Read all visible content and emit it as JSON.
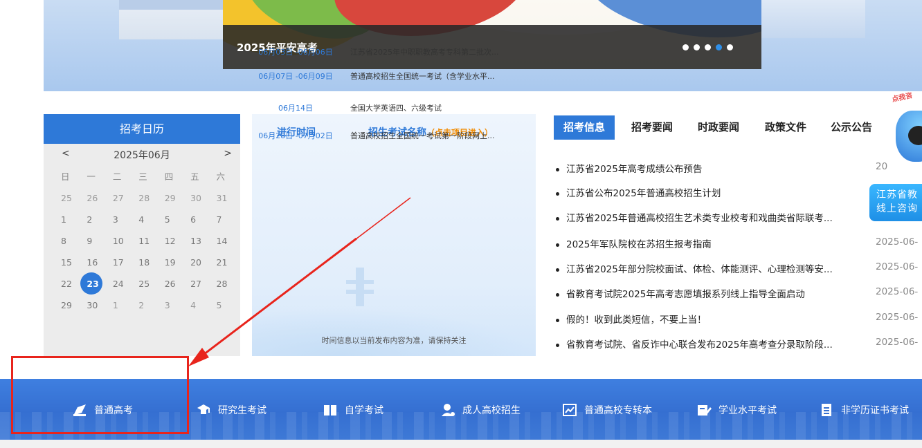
{
  "banner": {
    "caption": "2025年平安高考",
    "dots_total": 5,
    "dots_active_index": 3
  },
  "calendar": {
    "title": "招考日历",
    "prev": "<",
    "next": ">",
    "month": "2025年06月",
    "weekdays": [
      "日",
      "一",
      "二",
      "三",
      "四",
      "五",
      "六"
    ],
    "weeks": [
      [
        "25",
        "26",
        "27",
        "28",
        "29",
        "30",
        "31"
      ],
      [
        "1",
        "2",
        "3",
        "4",
        "5",
        "6",
        "7"
      ],
      [
        "8",
        "9",
        "10",
        "11",
        "12",
        "13",
        "14"
      ],
      [
        "15",
        "16",
        "17",
        "18",
        "19",
        "20",
        "21"
      ],
      [
        "22",
        "23",
        "24",
        "25",
        "26",
        "27",
        "28"
      ],
      [
        "29",
        "30",
        "1",
        "2",
        "3",
        "4",
        "5"
      ]
    ],
    "today": "23"
  },
  "schedule": {
    "head_time": "进行时间",
    "head_name": "招生考试名称",
    "head_hint": "（点击项目进入）",
    "rows": [
      {
        "time": "06月03日 -06月06日",
        "name": "江苏省2025年中职职教高考专科第二批次..."
      },
      {
        "time": "06月07日 -06月09日",
        "name": "普通高校招生全国统一考试（含学业水平..."
      },
      {
        "time": "06月14日",
        "name": "全国大学英语四、六级考试"
      },
      {
        "time": "06月28日 -07月02日",
        "name": "普通高校招生全国统一考试第一阶段网上..."
      }
    ],
    "note": "时间信息以当前发布内容为准，请保持关注"
  },
  "news": {
    "tabs": [
      "招考信息",
      "招考要闻",
      "时政要闻",
      "政策文件",
      "公示公告"
    ],
    "active_tab": "招考信息",
    "items": [
      {
        "title": "江苏省2025年高考成绩公布预告",
        "date": "20"
      },
      {
        "title": "江苏省公布2025年普通高校招生计划",
        "date": ""
      },
      {
        "title": "江苏省2025年普通高校招生艺术类专业校考和戏曲类省际联考...",
        "date": ""
      },
      {
        "title": "2025年军队院校在苏招生报考指南",
        "date": "2025-06-"
      },
      {
        "title": "江苏省2025年部分院校面试、体检、体能测评、心理检测等安...",
        "date": "2025-06-"
      },
      {
        "title": "省教育考试院2025年高考志愿填报系列线上指导全面启动",
        "date": "2025-06-"
      },
      {
        "title": "假的！收到此类短信，不要上当！",
        "date": "2025-06-"
      },
      {
        "title": "省教育考试院、省反诈中心联合发布2025年高考查分录取阶段...",
        "date": "2025-06-"
      }
    ]
  },
  "robot": {
    "hint": "点我咨",
    "line1": "江苏省教",
    "line2": "线上咨询"
  },
  "nav": {
    "items": [
      {
        "label": "普通高考",
        "icon": "pen-icon"
      },
      {
        "label": "研究生考试",
        "icon": "graduation-cap-icon"
      },
      {
        "label": "自学考试",
        "icon": "book-icon"
      },
      {
        "label": "成人高校招生",
        "icon": "person-icon"
      },
      {
        "label": "普通高校专转本",
        "icon": "chart-board-icon"
      },
      {
        "label": "学业水平考试",
        "icon": "edit-form-icon"
      },
      {
        "label": "非学历证书考试",
        "icon": "document-icon"
      }
    ]
  },
  "colors": {
    "primary": "#2e79d8",
    "nav_bg": "#3f7fe0",
    "hint_orange": "#f08a00",
    "annotation_red": "#e8241c"
  }
}
